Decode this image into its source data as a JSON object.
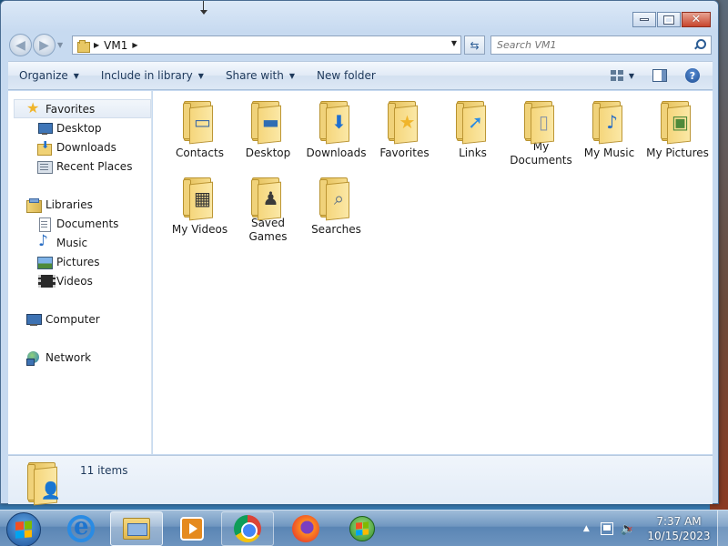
{
  "window": {
    "breadcrumb": [
      "VM1"
    ],
    "search_placeholder": "Search VM1"
  },
  "command_bar": {
    "organize": "Organize",
    "include_in_library": "Include in library",
    "share_with": "Share with",
    "new_folder": "New folder"
  },
  "nav": {
    "favorites": {
      "label": "Favorites",
      "items": [
        {
          "label": "Desktop",
          "icon": "desktop-icon"
        },
        {
          "label": "Downloads",
          "icon": "downloads-icon"
        },
        {
          "label": "Recent Places",
          "icon": "recent-places-icon"
        }
      ]
    },
    "libraries": {
      "label": "Libraries",
      "items": [
        {
          "label": "Documents",
          "icon": "documents-icon"
        },
        {
          "label": "Music",
          "icon": "music-icon"
        },
        {
          "label": "Pictures",
          "icon": "pictures-icon"
        },
        {
          "label": "Videos",
          "icon": "videos-icon"
        }
      ]
    },
    "computer": "Computer",
    "network": "Network"
  },
  "folders": [
    {
      "name": "Contacts",
      "badge": "contact-card"
    },
    {
      "name": "Desktop",
      "badge": "desktop"
    },
    {
      "name": "Downloads",
      "badge": "down-arrow"
    },
    {
      "name": "Favorites",
      "badge": "star"
    },
    {
      "name": "Links",
      "badge": "link-arrow"
    },
    {
      "name": "My Documents",
      "badge": "document"
    },
    {
      "name": "My Music",
      "badge": "music-note"
    },
    {
      "name": "My Pictures",
      "badge": "picture"
    },
    {
      "name": "My Videos",
      "badge": "film"
    },
    {
      "name": "Saved Games",
      "badge": "chess-piece"
    },
    {
      "name": "Searches",
      "badge": "magnifier"
    }
  ],
  "details": {
    "item_count": "11 items"
  },
  "taskbar": {
    "time": "7:37 AM",
    "date": "10/15/2023",
    "apps": [
      "Internet Explorer",
      "Windows Explorer",
      "Media Player",
      "Google Chrome",
      "Firefox",
      "Windows"
    ]
  },
  "colors": {
    "accent": "#1e395b",
    "folder": "#f0d276",
    "close_button": "#c7452c"
  }
}
